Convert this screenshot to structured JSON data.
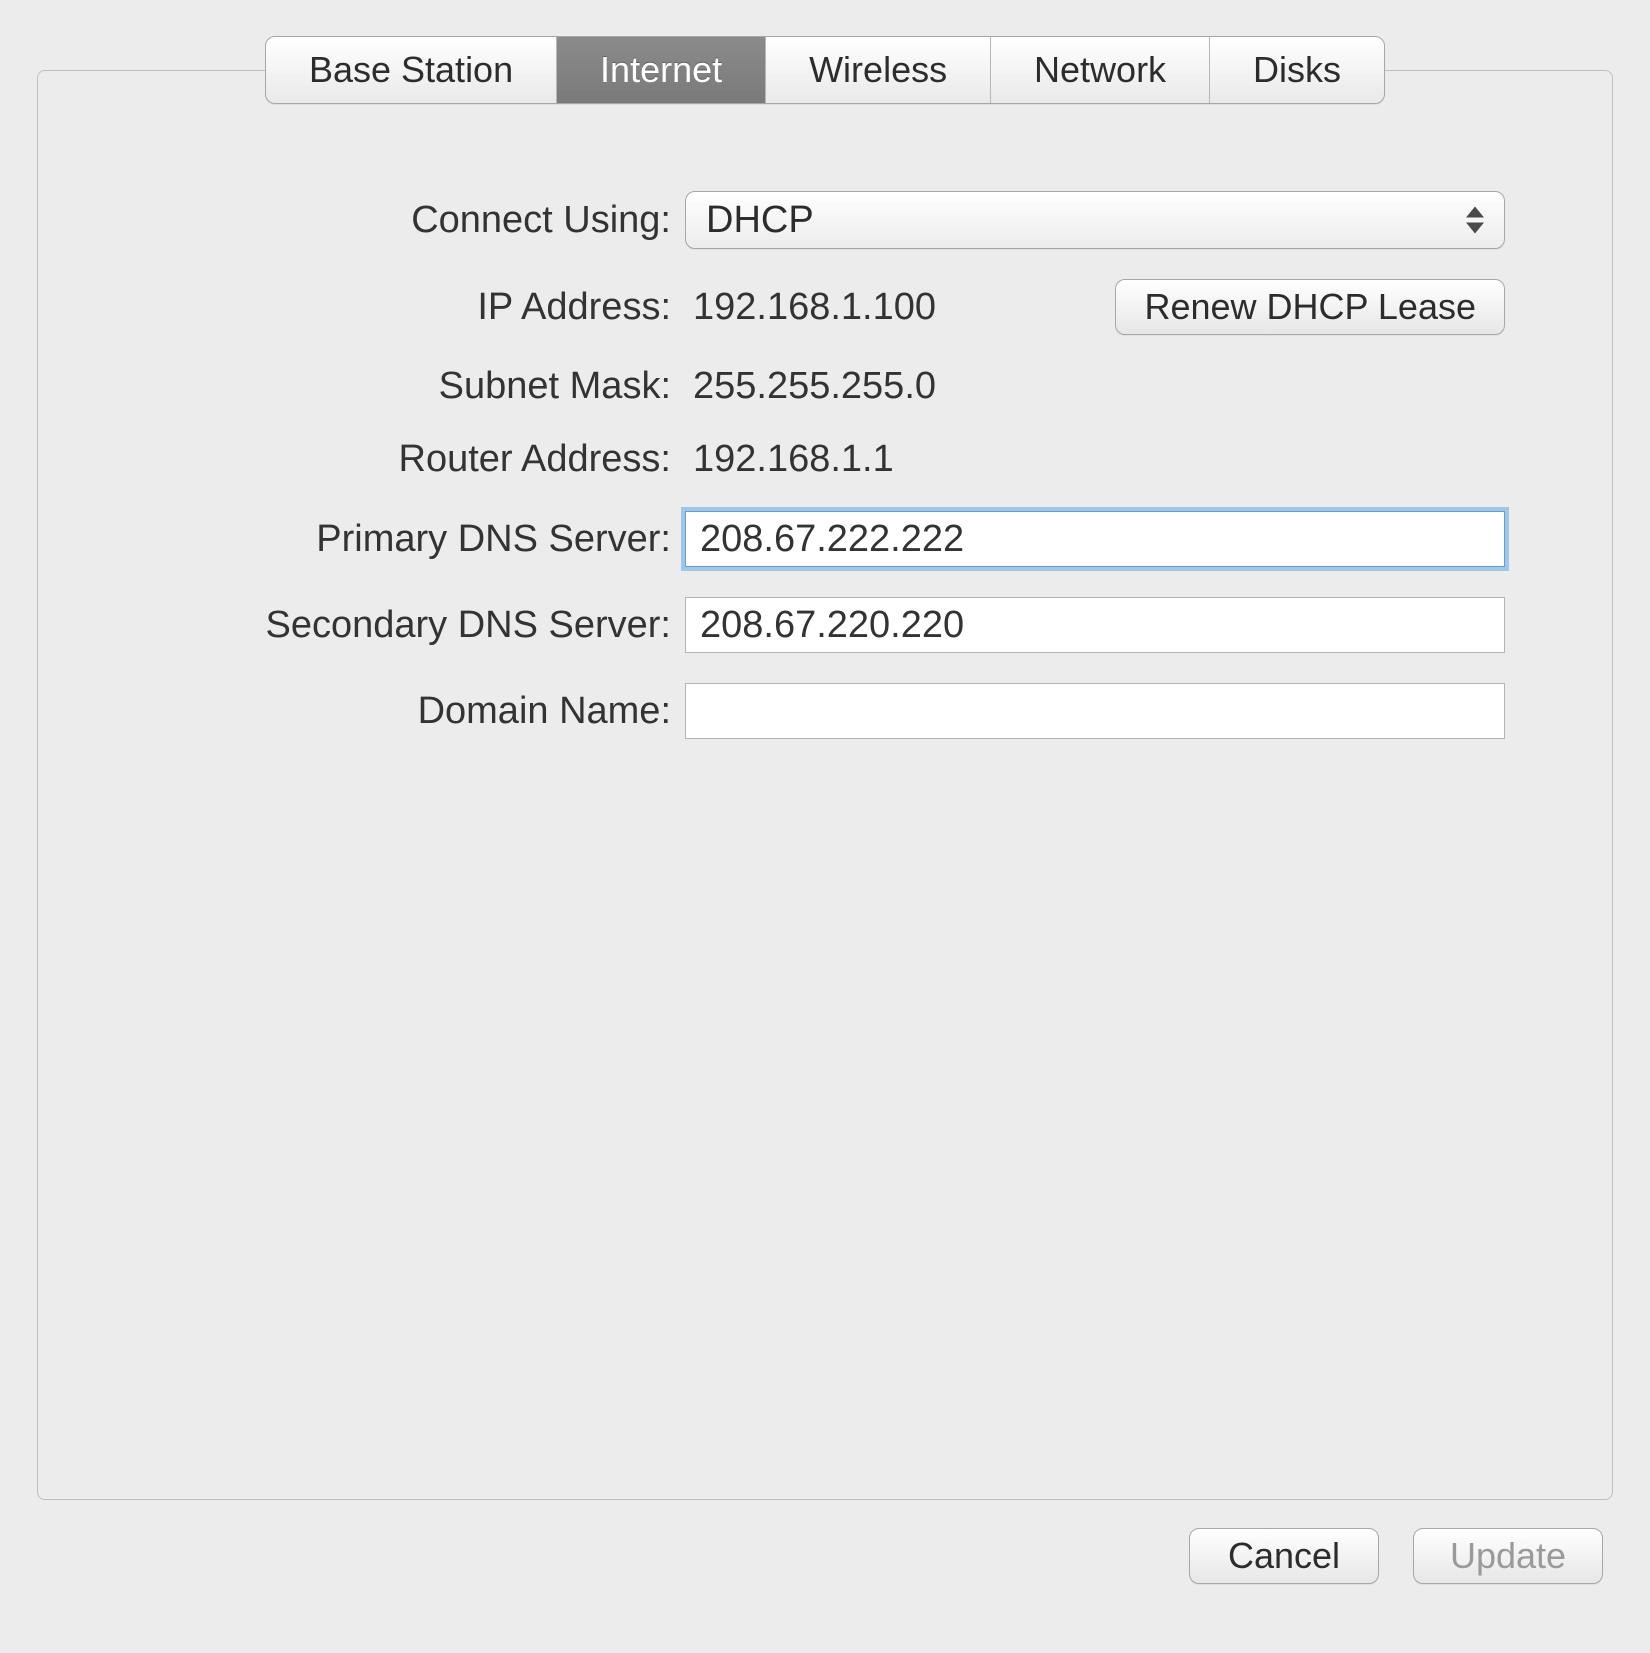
{
  "tabs": {
    "items": [
      {
        "label": "Base Station",
        "selected": false
      },
      {
        "label": "Internet",
        "selected": true
      },
      {
        "label": "Wireless",
        "selected": false
      },
      {
        "label": "Network",
        "selected": false
      },
      {
        "label": "Disks",
        "selected": false
      }
    ]
  },
  "labels": {
    "connect_using": "Connect Using:",
    "ip_address": "IP Address:",
    "subnet_mask": "Subnet Mask:",
    "router_address": "Router Address:",
    "primary_dns": "Primary DNS Server:",
    "secondary_dns": "Secondary DNS Server:",
    "domain_name": "Domain Name:"
  },
  "values": {
    "connect_using": "DHCP",
    "ip_address": "192.168.1.100",
    "subnet_mask": "255.255.255.0",
    "router_address": "192.168.1.1",
    "primary_dns": "208.67.222.222",
    "secondary_dns": "208.67.220.220",
    "domain_name": ""
  },
  "buttons": {
    "renew_dhcp": "Renew DHCP Lease",
    "cancel": "Cancel",
    "update": "Update"
  },
  "button_state": {
    "update_enabled": false
  }
}
